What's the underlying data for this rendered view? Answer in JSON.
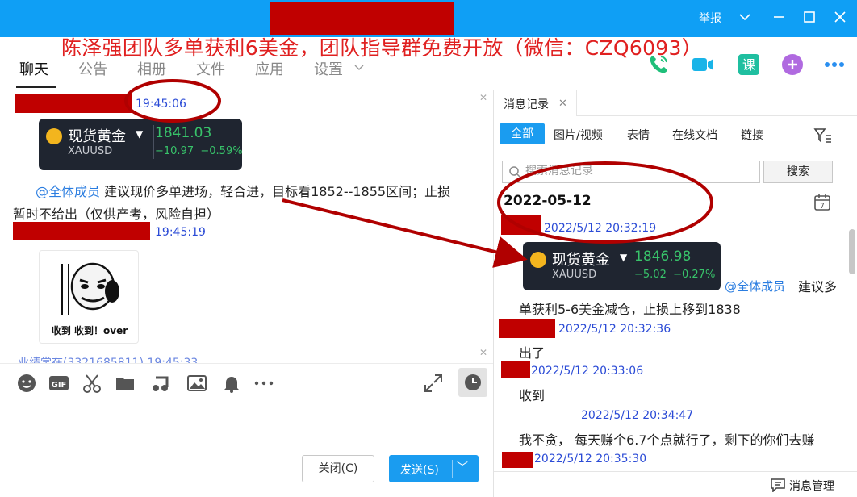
{
  "window": {
    "report_label": "举报",
    "accent": "#0f9ff5"
  },
  "banner": {
    "text": "陈泽强团队多单获利6美金，团队指导群免费开放（微信：CZQ6093）",
    "color": "#e02020"
  },
  "tabs": [
    {
      "label": "聊天",
      "active": true
    },
    {
      "label": "公告"
    },
    {
      "label": "相册"
    },
    {
      "label": "文件"
    },
    {
      "label": "应用"
    },
    {
      "label": "设置"
    }
  ],
  "top_icons": [
    "phone-icon",
    "video-icon",
    "lesson-icon",
    "add-icon",
    "more-icon"
  ],
  "chat": {
    "messages": [
      {
        "time": "19:45:06"
      },
      {
        "card": {
          "name": "现货黄金",
          "symbol": "XAUUSD",
          "price": "1841.03",
          "change": "−10.97",
          "change_pct": "−0.59%"
        }
      },
      {
        "mention": "@全体成员",
        "text_line1": "建议现价多单进场，轻合进，目标看1852--1855区间；止损",
        "text_line2": "暂时不给出（仅供产考，风险自担）"
      },
      {
        "time": "19:45:19"
      },
      {
        "sticker_caption": "收到 收到！over"
      },
      {
        "partial": "业绩常在(3321685811)  19:45:33"
      }
    ]
  },
  "toolbar": {
    "tools": [
      "emoji-icon",
      "gif-icon",
      "scissors-icon",
      "folder-icon",
      "music-icon",
      "image-icon",
      "bell-icon",
      "more-dots-icon"
    ],
    "close_label": "关闭(C)",
    "send_label": "发送(S)"
  },
  "history": {
    "tab_label": "消息记录",
    "filters": [
      "全部",
      "图片/视频",
      "表情",
      "在线文档",
      "链接"
    ],
    "search_placeholder": "搜索消息记录",
    "search_button": "搜索",
    "date": "2022-05-12",
    "entries": [
      {
        "time": "2022/5/12 20:32:19"
      },
      {
        "card": {
          "name": "现货黄金",
          "symbol": "XAUUSD",
          "price": "1846.98",
          "change": "−5.02",
          "change_pct": "−0.27%"
        }
      },
      {
        "mention": "@全体成员",
        "text_tail": "建议多",
        "text": "单获利5-6美金减仓，止损上移到1838"
      },
      {
        "time": "2022/5/12 20:32:36"
      },
      {
        "text": "出了"
      },
      {
        "time": "2022/5/12 20:33:06"
      },
      {
        "text": "收到"
      },
      {
        "time": "2022/5/12 20:34:47"
      },
      {
        "text": "我不贪， 每天赚个6.7个点就行了，剩下的你们去赚"
      },
      {
        "time": "2022/5/12 20:35:30"
      }
    ],
    "manage_label": "消息管理"
  }
}
